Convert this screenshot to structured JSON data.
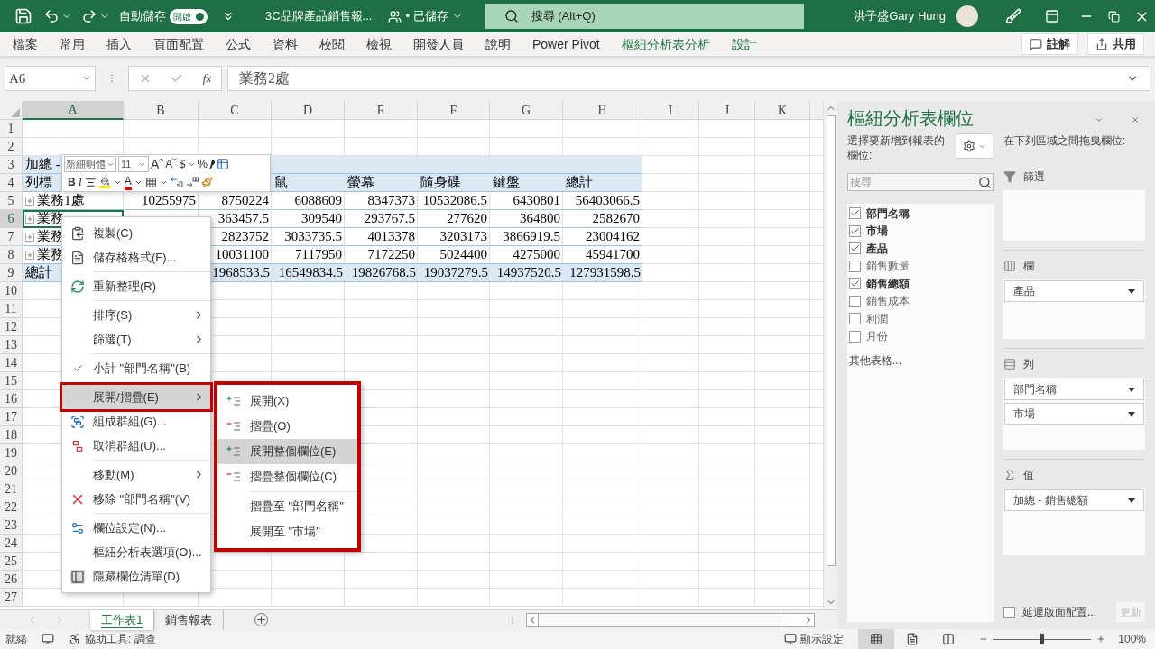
{
  "title_bar": {
    "autosave_label": "自動儲存",
    "autosave_toggle": {
      "label": "開啟",
      "on": true
    },
    "document_title": "3C品牌產品銷售報...",
    "save_status": "• 已儲存",
    "search": {
      "placeholder": "搜尋 (Alt+Q)"
    },
    "user_name": "洪子盛Gary Hung"
  },
  "ribbon_tabs": [
    {
      "label": "檔案",
      "contextual": false
    },
    {
      "label": "常用",
      "contextual": false
    },
    {
      "label": "插入",
      "contextual": false
    },
    {
      "label": "頁面配置",
      "contextual": false
    },
    {
      "label": "公式",
      "contextual": false
    },
    {
      "label": "資料",
      "contextual": false
    },
    {
      "label": "校閱",
      "contextual": false
    },
    {
      "label": "檢視",
      "contextual": false
    },
    {
      "label": "開發人員",
      "contextual": false
    },
    {
      "label": "說明",
      "contextual": false
    },
    {
      "label": "Power Pivot",
      "contextual": false
    },
    {
      "label": "樞紐分析表分析",
      "contextual": true
    },
    {
      "label": "設計",
      "contextual": true
    }
  ],
  "ribbon_buttons": [
    "註解",
    "共用"
  ],
  "formula_bar": {
    "name_box": "A6",
    "function_label": "fx",
    "formula": "業務2處"
  },
  "sheet": {
    "columns": [
      {
        "label": "A",
        "selected": true
      },
      {
        "label": "B",
        "selected": false
      },
      {
        "label": "C",
        "selected": false
      },
      {
        "label": "D",
        "selected": false
      },
      {
        "label": "E",
        "selected": false
      },
      {
        "label": "F",
        "selected": false
      },
      {
        "label": "G",
        "selected": false
      },
      {
        "label": "H",
        "selected": false
      },
      {
        "label": "I",
        "selected": false
      },
      {
        "label": "J",
        "selected": false
      },
      {
        "label": "K",
        "selected": false
      }
    ],
    "rows": [
      {
        "number": "1",
        "kind": "blank",
        "selected": false
      },
      {
        "number": "2",
        "kind": "blank",
        "selected": false
      },
      {
        "number": "3",
        "kind": "header",
        "selected": false,
        "cells": [
          {
            "text": "加總 -"
          }
        ]
      },
      {
        "number": "4",
        "kind": "header",
        "selected": false,
        "cells": [
          {
            "text": "列標"
          },
          {},
          {},
          {
            "text": "鼠"
          },
          {
            "text": "螢幕"
          },
          {
            "text": "隨身碟"
          },
          {
            "text": "鍵盤"
          },
          {
            "text": "總計"
          }
        ]
      },
      {
        "number": "5",
        "kind": "data",
        "selected": false,
        "cells": [
          {
            "text": "業務1處",
            "collapsed": true
          },
          {
            "text": "10255975"
          },
          {
            "text": "8750224"
          },
          {
            "text": "6088609"
          },
          {
            "text": "8347373"
          },
          {
            "text": "10532086.5"
          },
          {
            "text": "6430801"
          },
          {
            "text": "56403066.5"
          }
        ]
      },
      {
        "number": "6",
        "kind": "data",
        "selected": true,
        "cells": [
          {
            "text": "業務",
            "collapsed": true
          },
          {},
          {
            "text": "363457.5"
          },
          {
            "text": "309540"
          },
          {
            "text": "293767.5"
          },
          {
            "text": "277620"
          },
          {
            "text": "364800"
          },
          {
            "text": "2582670"
          }
        ]
      },
      {
        "number": "7",
        "kind": "data",
        "selected": false,
        "cells": [
          {
            "text": "業務",
            "collapsed": true
          },
          {},
          {
            "text": "2823752"
          },
          {
            "text": "3033735.5"
          },
          {
            "text": "4013378"
          },
          {
            "text": "3203173"
          },
          {
            "text": "3866919.5"
          },
          {
            "text": "23004162"
          }
        ]
      },
      {
        "number": "8",
        "kind": "data",
        "selected": false,
        "cells": [
          {
            "text": "業務",
            "collapsed": true
          },
          {},
          {
            "text": "10031100"
          },
          {
            "text": "7117950"
          },
          {
            "text": "7172250"
          },
          {
            "text": "5024400"
          },
          {
            "text": "4275000"
          },
          {
            "text": "45941700"
          }
        ]
      },
      {
        "number": "9",
        "kind": "total",
        "selected": false,
        "cells": [
          {
            "text": "總計"
          },
          {},
          {
            "text": "1968533.5"
          },
          {
            "text": "16549834.5"
          },
          {
            "text": "19826768.5"
          },
          {
            "text": "19037279.5"
          },
          {
            "text": "14937520.5"
          },
          {
            "text": "127931598.5"
          }
        ]
      },
      {
        "number": "10",
        "kind": "blank",
        "selected": false
      },
      {
        "number": "11",
        "kind": "blank",
        "selected": false
      },
      {
        "number": "12",
        "kind": "blank",
        "selected": false
      },
      {
        "number": "13",
        "kind": "blank",
        "selected": false
      },
      {
        "number": "14",
        "kind": "blank",
        "selected": false
      },
      {
        "number": "15",
        "kind": "blank",
        "selected": false
      },
      {
        "number": "16",
        "kind": "blank",
        "selected": false
      },
      {
        "number": "17",
        "kind": "blank",
        "selected": false
      },
      {
        "number": "18",
        "kind": "blank",
        "selected": false
      },
      {
        "number": "19",
        "kind": "blank",
        "selected": false
      },
      {
        "number": "20",
        "kind": "blank",
        "selected": false
      },
      {
        "number": "21",
        "kind": "blank",
        "selected": false
      },
      {
        "number": "22",
        "kind": "blank",
        "selected": false
      },
      {
        "number": "23",
        "kind": "blank",
        "selected": false
      },
      {
        "number": "24",
        "kind": "blank",
        "selected": false
      },
      {
        "number": "25",
        "kind": "blank",
        "selected": false
      },
      {
        "number": "26",
        "kind": "blank",
        "selected": false
      },
      {
        "number": "27",
        "kind": "blank",
        "selected": false
      }
    ]
  },
  "mini_toolbar": {
    "font": "新細明體",
    "size": "11",
    "grow_font": "A",
    "shrink_font": "A",
    "currency": "$",
    "percent": "%",
    "bold": "B",
    "italic": "I",
    "font_color": "A"
  },
  "context_menu": {
    "sections": [
      [
        {
          "label": "複製(C)",
          "submenu": false,
          "checked": false,
          "selected": false,
          "outlined": false
        },
        {
          "label": "儲存格格式(F)...",
          "submenu": false,
          "checked": false,
          "selected": false,
          "outlined": false
        }
      ],
      [
        {
          "label": "重新整理(R)",
          "submenu": false,
          "checked": false,
          "selected": false,
          "outlined": false
        }
      ],
      [
        {
          "label": "排序(S)",
          "submenu": true,
          "checked": false,
          "selected": false,
          "outlined": false
        },
        {
          "label": "篩選(T)",
          "submenu": true,
          "checked": false,
          "selected": false,
          "outlined": false
        }
      ],
      [
        {
          "label": "小計 \"部門名稱\"(B)",
          "submenu": false,
          "checked": true,
          "selected": false,
          "outlined": false
        }
      ],
      [
        {
          "label": "展開/摺疊(E)",
          "submenu": true,
          "checked": false,
          "selected": true,
          "outlined": true
        },
        {
          "label": "組成群組(G)...",
          "submenu": false,
          "checked": false,
          "selected": false,
          "outlined": false
        },
        {
          "label": "取消群組(U)...",
          "submenu": false,
          "checked": false,
          "selected": false,
          "outlined": false
        }
      ],
      [
        {
          "label": "移動(M)",
          "submenu": true,
          "checked": false,
          "selected": false,
          "outlined": false
        },
        {
          "label": "移除 \"部門名稱\"(V)",
          "submenu": false,
          "checked": false,
          "selected": false,
          "outlined": false
        }
      ],
      [
        {
          "label": "欄位設定(N)...",
          "submenu": false,
          "checked": false,
          "selected": false,
          "outlined": false
        },
        {
          "label": "樞紐分析表選項(O)...",
          "submenu": false,
          "checked": false,
          "selected": false,
          "outlined": false
        },
        {
          "label": "隱藏欄位清單(D)",
          "submenu": false,
          "checked": false,
          "selected": false,
          "outlined": false
        }
      ]
    ]
  },
  "submenu": {
    "outlined": true,
    "sections": [
      [
        {
          "label": "展開(X)",
          "kind": "expand",
          "selected": false
        },
        {
          "label": "摺疊(O)",
          "kind": "collapse",
          "selected": false
        },
        {
          "label": "展開整個欄位(E)",
          "kind": "expand",
          "selected": true
        },
        {
          "label": "摺疊整個欄位(C)",
          "kind": "collapse",
          "selected": false
        }
      ],
      [
        {
          "label": "摺疊至 \"部門名稱\"",
          "kind": "plain",
          "selected": false
        },
        {
          "label": "展開至 \"市場\"",
          "kind": "plain",
          "selected": false
        }
      ]
    ]
  },
  "sheet_tabs": [
    {
      "label": "工作表1",
      "selected": true
    },
    {
      "label": "銷售報表",
      "selected": false
    }
  ],
  "pivot_panel": {
    "title": "樞紐分析表欄位",
    "prompt": "選擇要新增到報表的欄位:",
    "search": {
      "placeholder": "搜尋"
    },
    "fields": [
      {
        "label": "部門名稱",
        "checked": true
      },
      {
        "label": "市場",
        "checked": true
      },
      {
        "label": "產品",
        "checked": true
      },
      {
        "label": "銷售數量",
        "checked": false
      },
      {
        "label": "銷售總額",
        "checked": true
      },
      {
        "label": "銷售成本",
        "checked": false
      },
      {
        "label": "利潤",
        "checked": false
      },
      {
        "label": "月份",
        "checked": false
      }
    ],
    "more_tables": "其他表格...",
    "drag_hint": "在下列區域之間拖曳欄位:",
    "areas": [
      {
        "kind": "filter",
        "title": "篩選"
      },
      {
        "kind": "columns",
        "title": "欄",
        "items": [
          "產品"
        ]
      },
      {
        "kind": "rows",
        "title": "列",
        "items": [
          "部門名稱",
          "市場"
        ]
      },
      {
        "kind": "values",
        "title": "值",
        "items": [
          "加總 - 銷售總額"
        ]
      }
    ],
    "defer": {
      "label": "延遲版面配置...",
      "checked": false
    },
    "update_button": {
      "label": "更新",
      "disabled": true
    }
  },
  "status_bar": {
    "status": "就緒",
    "accessibility": "協助工具: 調查",
    "display_settings": "顯示設定",
    "views": [
      {
        "selected": true
      },
      {
        "selected": false
      },
      {
        "selected": false
      }
    ],
    "zoom": {
      "level": 0.5
    },
    "zoom_label": "100%"
  }
}
